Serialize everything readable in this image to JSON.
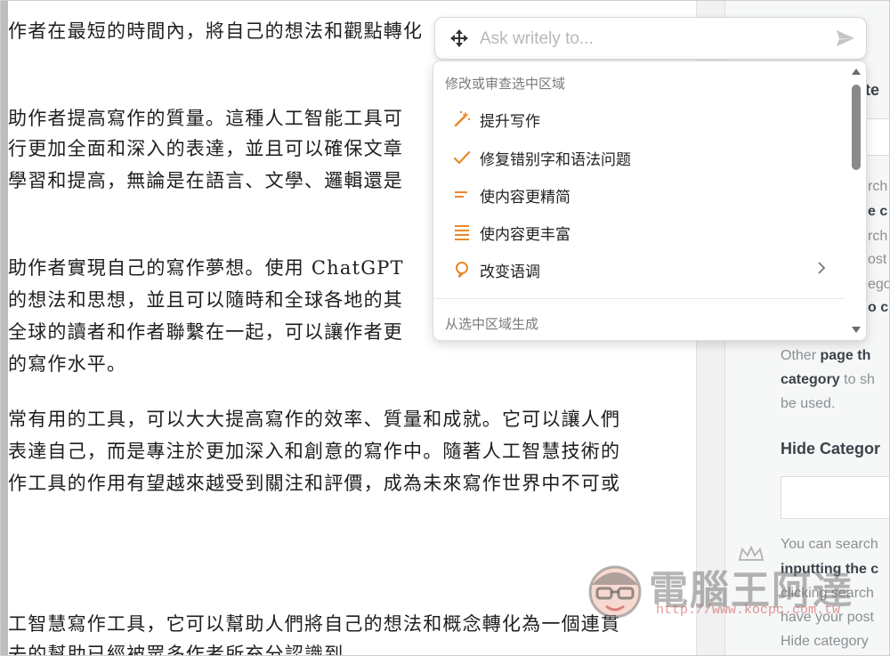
{
  "editor": {
    "lines": [
      "作者在最短的時間內，將自己的想法和觀點轉化",
      "助作者提高寫作的質量。這種人工智能工具可",
      "行更加全面和深入的表達，並且可以確保文章",
      "學習和提高，無論是在語言、文學、邏輯還是",
      "助作者實現自己的寫作夢想。使用 ChatGPT",
      "的想法和思想，並且可以隨時和全球各地的其",
      "全球的讀者和作者聯繫在一起，可以讓作者更",
      "的寫作水平。",
      "常有用的工具，可以大大提高寫作的效率、質量和成就。它可以讓人們",
      "表達自己，而是專注於更加深入和創意的寫作中。隨著人工智慧技術的",
      "作工具的作用有望越來越受到關注和評價，成為未來寫作世界中不可或",
      "工智慧寫作工具，它可以幫助人們將自己的想法和概念轉化為一個連貫",
      "去的幫助已經被眾多作者所充分認識到"
    ]
  },
  "ask": {
    "placeholder": "Ask writely to...",
    "move_icon": "move-icon",
    "send_icon": "send-icon"
  },
  "menu": {
    "section_modify": "修改或审查选中区域",
    "items": [
      {
        "label": "提升写作",
        "icon": "magic-wand-icon",
        "color": "#e8892b"
      },
      {
        "label": "修复错别字和语法问题",
        "icon": "check-icon",
        "color": "#e8892b"
      },
      {
        "label": "使内容更精简",
        "icon": "short-text-icon",
        "color": "#e8892b"
      },
      {
        "label": "使内容更丰富",
        "icon": "long-text-icon",
        "color": "#e8892b"
      },
      {
        "label": "改变语调",
        "icon": "speech-bubble-icon",
        "color": "#e8892b"
      }
    ],
    "section_generate": "从选中区域生成"
  },
  "sidebar": {
    "fragments": [
      "te",
      "rch",
      "e c",
      "rch",
      "ost",
      "ego",
      "o c"
    ],
    "other_prefix": "Other ",
    "other_bold": "page th",
    "category_bold": "category",
    "category_rest": " to sh",
    "be_used": "be used.",
    "hide_title": "Hide Categor",
    "you_can": "You can search",
    "inputting": "inputting the c",
    "clicking": "clicking search",
    "have_your": "have your post",
    "hide_category": "Hide category"
  },
  "watermark": {
    "title": "電腦王阿達",
    "url": "http://www.kocpc.com.tw"
  },
  "colors": {
    "accent": "#e8892b"
  }
}
